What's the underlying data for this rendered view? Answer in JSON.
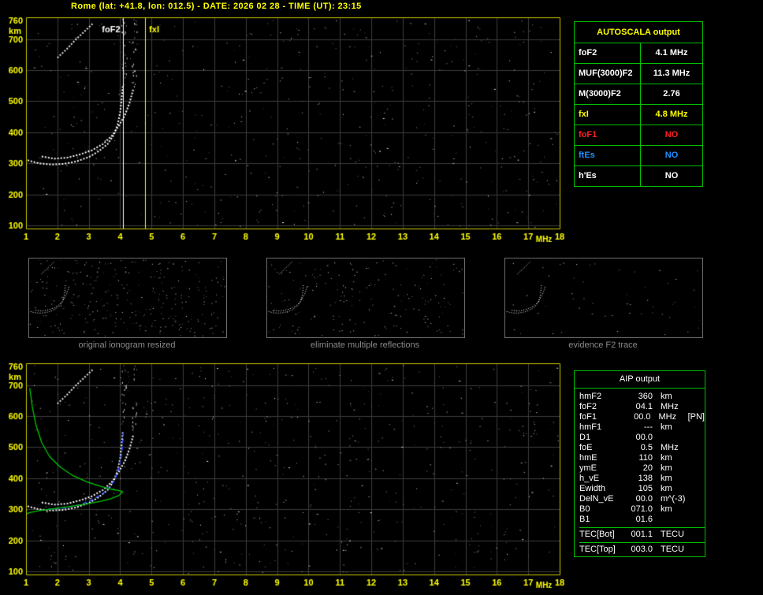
{
  "title": "Rome (lat: +41.8, lon: 012.5) - DATE: 2026 02 28 - TIME (UT): 23:15",
  "colors": {
    "background": "#000000",
    "accent_yellow": "#ffff00",
    "grid": "#3c3c3c",
    "border_yellow": "#c8c800",
    "table_green": "#00c000",
    "trace_white": "#ffffff",
    "fit_blue": "#3050ff",
    "profile_green": "#00c800",
    "status_red": "#ff2020",
    "status_blue": "#2090ff",
    "caption_gray": "#8a8a8a"
  },
  "autoscala_table": {
    "title": "AUTOSCALA output",
    "rows": [
      {
        "label": "foF2",
        "value": "4.1 MHz",
        "color": "#ffffff"
      },
      {
        "label": "MUF(3000)F2",
        "value": "11.3 MHz",
        "color": "#ffffff"
      },
      {
        "label": "M(3000)F2",
        "value": "2.76",
        "color": "#ffffff"
      },
      {
        "label": "fxI",
        "value": "4.8 MHz",
        "color": "#ffff00"
      },
      {
        "label": "foF1",
        "value": "NO",
        "color": "#ff2020"
      },
      {
        "label": "ftEs",
        "value": "NO",
        "color": "#2090ff"
      },
      {
        "label": "h'Es",
        "value": "NO",
        "color": "#ffffff"
      }
    ]
  },
  "aip_table": {
    "title": "AIP output",
    "rows": [
      {
        "label": "hmF2",
        "value": "360",
        "unit": "km",
        "extra": ""
      },
      {
        "label": "foF2",
        "value": "04.1",
        "unit": "MHz",
        "extra": ""
      },
      {
        "label": "foF1",
        "value": "00.0",
        "unit": "MHz",
        "extra": "[PN]"
      },
      {
        "label": "hmF1",
        "value": "---",
        "unit": "km",
        "extra": ""
      },
      {
        "label": "D1",
        "value": "00.0",
        "unit": "",
        "extra": ""
      },
      {
        "label": "foE",
        "value": "0.5",
        "unit": "MHz",
        "extra": ""
      },
      {
        "label": "hmE",
        "value": "110",
        "unit": "km",
        "extra": ""
      },
      {
        "label": "ymE",
        "value": "20",
        "unit": "km",
        "extra": ""
      },
      {
        "label": "h_vE",
        "value": "138",
        "unit": "km",
        "extra": ""
      },
      {
        "label": "Ewidth",
        "value": "105",
        "unit": "km",
        "extra": ""
      },
      {
        "label": "DelN_vE",
        "value": "00.0",
        "unit": "m^(-3)",
        "extra": ""
      },
      {
        "label": "B0",
        "value": "071.0",
        "unit": "km",
        "extra": ""
      },
      {
        "label": "B1",
        "value": "01.6",
        "unit": "",
        "extra": ""
      }
    ],
    "tec_rows": [
      {
        "label": "TEC[Bot]",
        "value": "001.1",
        "unit": "TECU",
        "extra": ""
      },
      {
        "label": "TEC[Top]",
        "value": "003.0",
        "unit": "TECU",
        "extra": ""
      }
    ]
  },
  "thumbnails": [
    {
      "caption": "original ionogram resized",
      "noise": 300,
      "seed": 71
    },
    {
      "caption": "eliminate multiple reflections",
      "noise": 180,
      "seed": 82
    },
    {
      "caption": "evidence F2 trace",
      "noise": 55,
      "seed": 93
    }
  ],
  "chart_data": [
    {
      "id": "top-ionogram",
      "type": "scatter",
      "title": "ionogram with AUTOSCALA markers",
      "xlabel": "MHz",
      "ylabel": "km",
      "xlim": [
        1,
        18
      ],
      "ylim": [
        90,
        770
      ],
      "xticks": [
        1,
        2,
        3,
        4,
        5,
        6,
        7,
        8,
        9,
        10,
        11,
        12,
        13,
        14,
        15,
        16,
        17,
        18
      ],
      "yticks": [
        100,
        200,
        300,
        400,
        500,
        600,
        700,
        760
      ],
      "grid": true,
      "annotations": [
        {
          "text": "foF2",
          "x": 3.42,
          "y": 722,
          "color": "#ffffff"
        },
        {
          "text": "fxI",
          "x": 4.92,
          "y": 722,
          "color": "#ffff00"
        }
      ],
      "vlines": [
        {
          "x": 4.1,
          "color": "#ffffff",
          "label": "foF2 = 4.1 MHz"
        },
        {
          "x": 4.8,
          "color": "#ffff00",
          "label": "fxI = 4.8 MHz"
        }
      ],
      "series": [
        {
          "name": "F2-ordinary-trace",
          "kind": "trace",
          "color": "#ffffff",
          "points": [
            [
              1.05,
              310
            ],
            [
              1.4,
              300
            ],
            [
              1.8,
              296
            ],
            [
              2.2,
              298
            ],
            [
              2.6,
              306
            ],
            [
              3.0,
              320
            ],
            [
              3.3,
              338
            ],
            [
              3.6,
              362
            ],
            [
              3.8,
              392
            ],
            [
              3.92,
              425
            ],
            [
              4.0,
              465
            ],
            [
              4.05,
              510
            ],
            [
              4.08,
              548
            ]
          ]
        },
        {
          "name": "F2-extraordinary-trace",
          "kind": "trace",
          "color": "#ffffff",
          "points": [
            [
              1.5,
              322
            ],
            [
              1.9,
              315
            ],
            [
              2.3,
              318
            ],
            [
              2.7,
              328
            ],
            [
              3.1,
              342
            ],
            [
              3.45,
              362
            ],
            [
              3.75,
              390
            ],
            [
              3.95,
              420
            ],
            [
              4.15,
              455
            ],
            [
              4.3,
              495
            ],
            [
              4.42,
              540
            ]
          ]
        },
        {
          "name": "second-hop-trace",
          "kind": "trace",
          "color": "#e8e8e8",
          "points": [
            [
              2.0,
              640
            ],
            [
              2.3,
              668
            ],
            [
              2.6,
              700
            ],
            [
              2.9,
              728
            ],
            [
              3.15,
              752
            ]
          ]
        }
      ],
      "noise": {
        "count": 520,
        "seed": 1234
      },
      "spreads": [
        {
          "x": 4.12,
          "from": 550,
          "to": 768,
          "count": 22
        },
        {
          "x": 4.45,
          "from": 545,
          "to": 768,
          "count": 26
        }
      ]
    },
    {
      "id": "bottom-ionogram",
      "type": "scatter",
      "title": "ionogram with fitted trace and electron density profile",
      "xlabel": "MHz",
      "ylabel": "km",
      "xlim": [
        1,
        18
      ],
      "ylim": [
        90,
        770
      ],
      "xticks": [
        1,
        2,
        3,
        4,
        5,
        6,
        7,
        8,
        9,
        10,
        11,
        12,
        13,
        14,
        15,
        16,
        17,
        18
      ],
      "yticks": [
        100,
        200,
        300,
        400,
        500,
        600,
        700,
        760
      ],
      "grid": true,
      "annotations": [],
      "vlines": [],
      "series": [
        {
          "name": "F2-ordinary-trace",
          "kind": "trace",
          "color": "#ffffff",
          "points": [
            [
              1.05,
              310
            ],
            [
              1.4,
              300
            ],
            [
              1.8,
              296
            ],
            [
              2.2,
              298
            ],
            [
              2.6,
              306
            ],
            [
              3.0,
              320
            ],
            [
              3.3,
              338
            ],
            [
              3.6,
              362
            ],
            [
              3.8,
              392
            ],
            [
              3.92,
              425
            ],
            [
              4.0,
              465
            ],
            [
              4.05,
              510
            ],
            [
              4.08,
              548
            ]
          ]
        },
        {
          "name": "F2-extraordinary-trace",
          "kind": "trace",
          "color": "#ffffff",
          "points": [
            [
              1.5,
              322
            ],
            [
              1.9,
              315
            ],
            [
              2.3,
              318
            ],
            [
              2.7,
              328
            ],
            [
              3.1,
              342
            ],
            [
              3.45,
              362
            ],
            [
              3.75,
              390
            ],
            [
              3.95,
              420
            ],
            [
              4.15,
              455
            ],
            [
              4.3,
              495
            ],
            [
              4.42,
              540
            ]
          ]
        },
        {
          "name": "second-hop-trace",
          "kind": "trace",
          "color": "#e8e8e8",
          "points": [
            [
              2.0,
              640
            ],
            [
              2.3,
              668
            ],
            [
              2.6,
              700
            ],
            [
              2.9,
              728
            ],
            [
              3.15,
              752
            ]
          ]
        },
        {
          "name": "autoscala-fitted-trace",
          "kind": "fit",
          "color": "#3050ff",
          "points": [
            [
              1.7,
              300
            ],
            [
              2.2,
              304
            ],
            [
              2.7,
              314
            ],
            [
              3.1,
              330
            ],
            [
              3.5,
              355
            ],
            [
              3.8,
              390
            ],
            [
              3.95,
              430
            ],
            [
              4.05,
              480
            ],
            [
              4.1,
              548
            ]
          ]
        },
        {
          "name": "electron-density-profile",
          "kind": "profile",
          "color": "#00c800",
          "points": [
            [
              1.12,
              690
            ],
            [
              1.2,
              630
            ],
            [
              1.32,
              570
            ],
            [
              1.5,
              515
            ],
            [
              1.75,
              470
            ],
            [
              2.1,
              435
            ],
            [
              2.5,
              408
            ],
            [
              2.95,
              388
            ],
            [
              3.4,
              373
            ],
            [
              3.75,
              364
            ],
            [
              4.0,
              359
            ],
            [
              4.08,
              356
            ],
            [
              3.95,
              344
            ],
            [
              3.7,
              334
            ],
            [
              3.35,
              325
            ],
            [
              2.9,
              317
            ],
            [
              2.4,
              309
            ],
            [
              1.9,
              302
            ],
            [
              1.4,
              295
            ],
            [
              1.1,
              289
            ],
            [
              1.0,
              284
            ]
          ]
        }
      ],
      "noise": {
        "count": 560,
        "seed": 4321
      },
      "spreads": [
        {
          "x": 4.12,
          "from": 555,
          "to": 768,
          "count": 18
        },
        {
          "x": 4.45,
          "from": 550,
          "to": 768,
          "count": 20
        }
      ]
    }
  ]
}
